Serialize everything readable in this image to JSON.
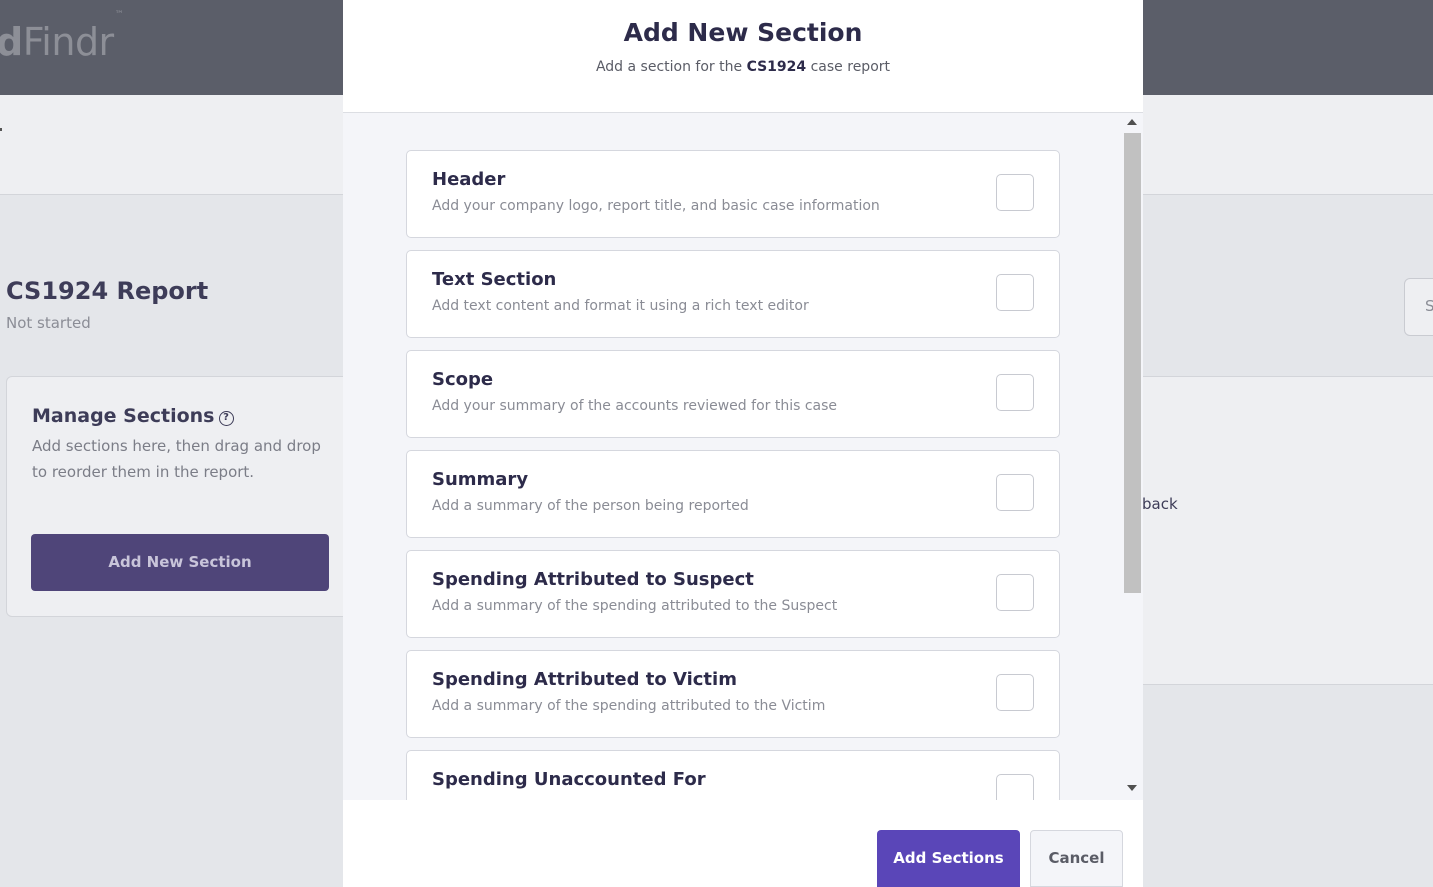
{
  "app": {
    "logo_prefix": "d",
    "logo_rest": "Findr",
    "logo_mark": "™"
  },
  "report": {
    "title": "CS1924 Report",
    "status": "Not started",
    "right_button_partial": "S"
  },
  "manage": {
    "title": "Manage Sections",
    "help_icon": "question-circle-icon",
    "description": "Add sections here, then drag and drop to reorder them in the report.",
    "add_button": "Add New Section"
  },
  "right_card": {
    "text_partial": "back"
  },
  "modal": {
    "title": "Add New Section",
    "subtitle_prefix": "Add a section for the",
    "subtitle_case": "CS1924",
    "subtitle_suffix": "case report",
    "sections": [
      {
        "name": "Header",
        "description": "Add your company logo, report title, and basic case information",
        "checked": false
      },
      {
        "name": "Text Section",
        "description": "Add text content and format it using a rich text editor",
        "checked": false
      },
      {
        "name": "Scope",
        "description": "Add your summary of the accounts reviewed for this case",
        "checked": false
      },
      {
        "name": "Summary",
        "description": "Add a summary of the person being reported",
        "checked": false
      },
      {
        "name": "Spending Attributed to Suspect",
        "description": "Add a summary of the spending attributed to the Suspect",
        "checked": false
      },
      {
        "name": "Spending Attributed to Victim",
        "description": "Add a summary of the spending attributed to the Victim",
        "checked": false
      },
      {
        "name": "Spending Unaccounted For",
        "description": "",
        "checked": false
      }
    ],
    "primary_button": "Add Sections",
    "cancel_button": "Cancel"
  },
  "colors": {
    "accent": "#5a46b8",
    "topbar": "#5b5e69",
    "body_bg": "#f4f5f9"
  }
}
